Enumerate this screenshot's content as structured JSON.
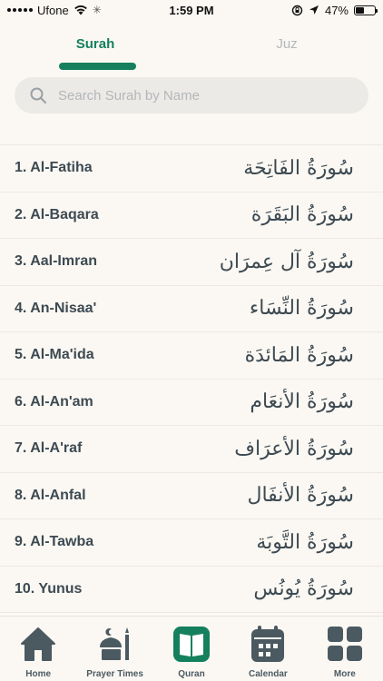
{
  "status_bar": {
    "carrier": "Ufone",
    "time": "1:59 PM",
    "battery": "47%",
    "battery_level": 0.47
  },
  "tabs": [
    {
      "label": "Surah",
      "active": true
    },
    {
      "label": "Juz",
      "active": false
    }
  ],
  "search": {
    "placeholder": "Search Surah by Name"
  },
  "surahs": [
    {
      "name": "1. Al-Fatiha",
      "arabic": "سُورَةُ الفَاتِحَة"
    },
    {
      "name": "2. Al-Baqara",
      "arabic": "سُورَةُ البَقَرَة"
    },
    {
      "name": "3. Aal-Imran",
      "arabic": "سُورَةُ آل عِمرَان"
    },
    {
      "name": "4. An-Nisaa'",
      "arabic": "سُورَةُ النِّسَاء"
    },
    {
      "name": "5. Al-Ma'ida",
      "arabic": "سُورَةُ المَائدَة"
    },
    {
      "name": "6. Al-An'am",
      "arabic": "سُورَةُ الأنعَام"
    },
    {
      "name": "7. Al-A'raf",
      "arabic": "سُورَةُ الأعرَاف"
    },
    {
      "name": "8. Al-Anfal",
      "arabic": "سُورَةُ الأنفَال"
    },
    {
      "name": "9. Al-Tawba",
      "arabic": "سُورَةُ التَّوبَة"
    },
    {
      "name": "10. Yunus",
      "arabic": "سُورَةُ يُونُس"
    }
  ],
  "bottom_nav": [
    {
      "label": "Home",
      "icon": "home-icon",
      "active": false
    },
    {
      "label": "Prayer Times",
      "icon": "mosque-icon",
      "active": false
    },
    {
      "label": "Quran",
      "icon": "quran-book-icon",
      "active": true
    },
    {
      "label": "Calendar",
      "icon": "calendar-icon",
      "active": false
    },
    {
      "label": "More",
      "icon": "grid-icon",
      "active": false
    }
  ],
  "colors": {
    "accent": "#14805e",
    "text": "#3d4a52",
    "background": "#fbf8f3"
  }
}
